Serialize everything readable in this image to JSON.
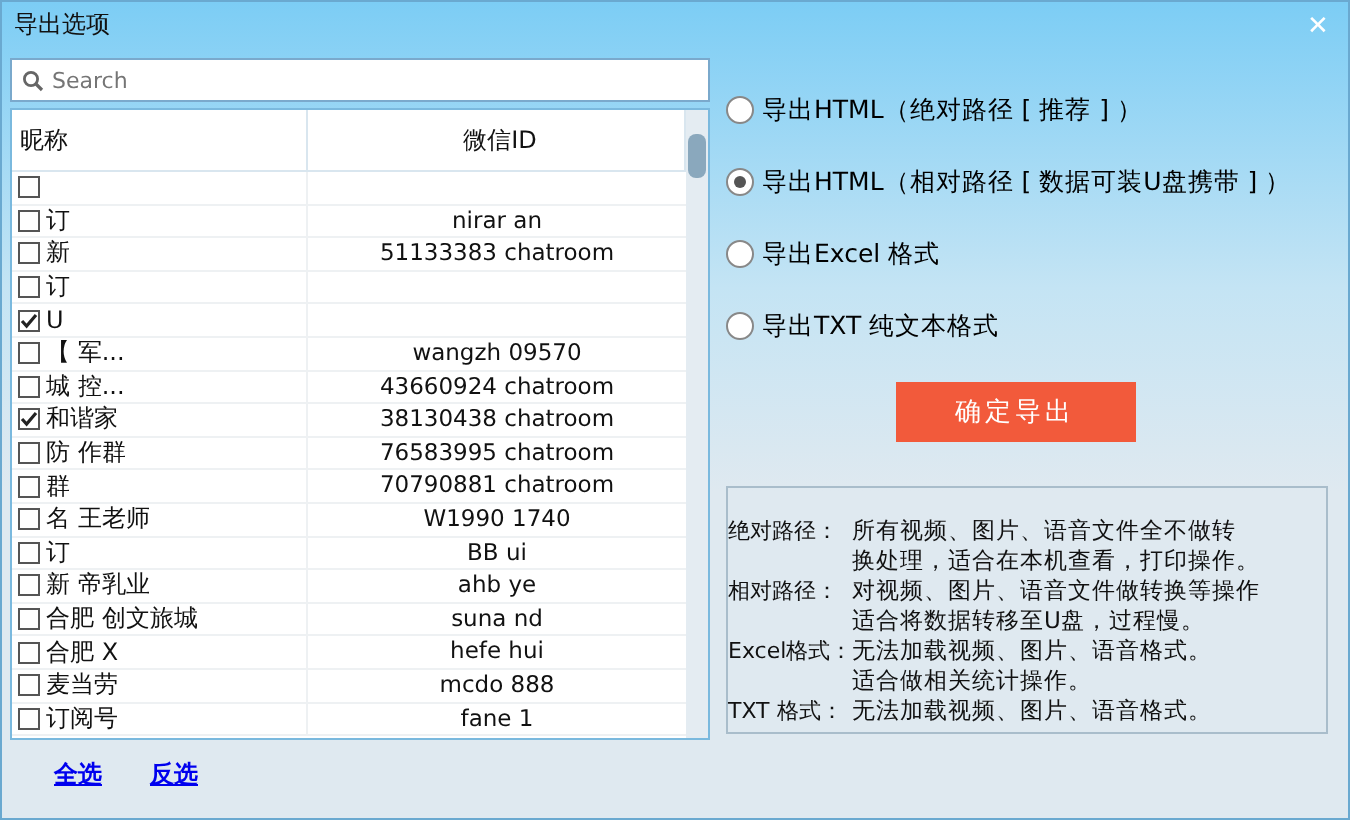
{
  "window": {
    "title": "导出选项",
    "close": "✕"
  },
  "search": {
    "placeholder": "Search"
  },
  "table": {
    "columns": [
      "昵称",
      "微信ID"
    ],
    "rows": [
      {
        "checked": false
      },
      {
        "checked": false,
        "name": "订",
        "id": "nirar an"
      },
      {
        "checked": false,
        "name": "新",
        "id": "51133383 chatroom"
      },
      {
        "checked": false,
        "name": "订"
      },
      {
        "checked": true,
        "name": "U"
      },
      {
        "checked": false,
        "name": "【 军...",
        "id": "wangzh 09570"
      },
      {
        "checked": false,
        "name": "城 控...",
        "id": "43660924 chatroom"
      },
      {
        "checked": true,
        "name": "和谐家",
        "id": "38130438 chatroom"
      },
      {
        "checked": false,
        "name": "防 作群",
        "id": "76583995 chatroom"
      },
      {
        "checked": false,
        "name": "群",
        "id": "70790881 chatroom"
      },
      {
        "checked": false,
        "name": "名 王老师",
        "id": "W1990 1740"
      },
      {
        "checked": false,
        "name": "订",
        "id": "BB ui"
      },
      {
        "checked": false,
        "name": "新 帝乳业",
        "id": "ahb ye"
      },
      {
        "checked": false,
        "name": "合肥 创文旅城",
        "id": "suna nd"
      },
      {
        "checked": false,
        "name": "合肥 X",
        "id": "hefe hui"
      },
      {
        "checked": false,
        "name": "麦当劳",
        "id": "mcdo 888"
      },
      {
        "checked": false,
        "name": "订阅号",
        "id": "fane 1"
      }
    ]
  },
  "links": [
    "全选",
    "反选"
  ],
  "options": [
    {
      "label": "导出HTML（绝对路径 [ 推荐 ] ）",
      "selected": false
    },
    {
      "label": "导出HTML（相对路径 [ 数据可装U盘携带 ] ）",
      "selected": true
    },
    {
      "label": "导出Excel 格式",
      "selected": false
    },
    {
      "label": "导出TXT 纯文本格式",
      "selected": false
    }
  ],
  "confirm_button": "确定导出",
  "notes": [
    {
      "term": "绝对路径：",
      "lines": [
        "所有视频、图片、语音文件全不做转",
        "换处理，适合在本机查看，打印操作。"
      ]
    },
    {
      "term": "相对路径：",
      "lines": [
        "对视频、图片、语音文件做转换等操作",
        "适合将数据转移至U盘，过程慢。"
      ]
    },
    {
      "term": "Excel格式：",
      "lines": [
        "无法加载视频、图片、语音格式。",
        "适合做相关统计操作。"
      ]
    },
    {
      "term": "TXT 格式：",
      "lines": [
        "无法加载视频、图片、语音格式。"
      ]
    }
  ]
}
